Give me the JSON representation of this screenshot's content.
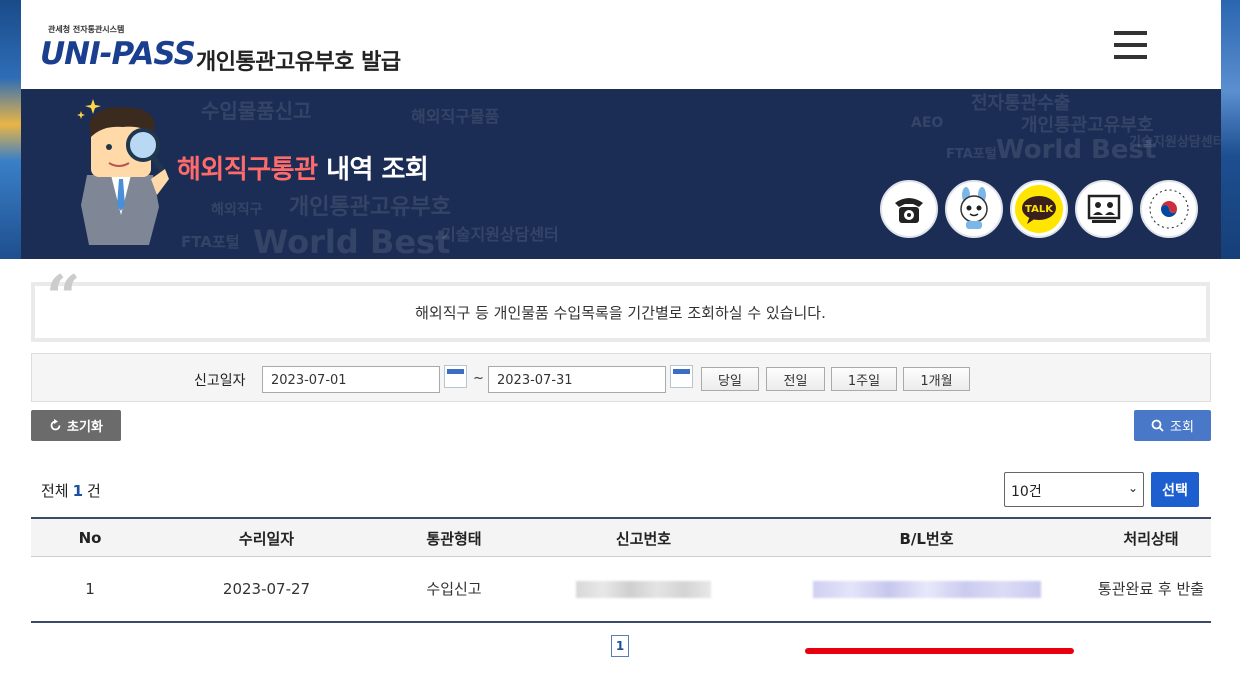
{
  "header": {
    "logo_small": "관세청 전자통관시스템",
    "logo_main": "UNI-PASS",
    "site_title": "개인통관고유부호 발급"
  },
  "banner": {
    "title_accent": "해외직구통관",
    "title_rest": " 내역 조회",
    "bg_words": [
      "수입물품신고",
      "해외직구물품",
      "개인통관고유부호",
      "World Best",
      "기술지원상담센터",
      "FTA포털",
      "전자통관수출",
      "AEO",
      "해외직구"
    ],
    "icons": [
      "phone-icon",
      "mascot-icon",
      "talk-icon",
      "consult-icon",
      "government-emblem-icon"
    ],
    "talk_label": "TALK"
  },
  "info": {
    "text": "해외직구 등 개인물품 수입목록을 기간별로 조회하실 수 있습니다."
  },
  "search": {
    "label": "신고일자",
    "date_from": "2023-07-01",
    "date_to": "2023-07-31",
    "tilde": "~",
    "periods": [
      "당일",
      "전일",
      "1주일",
      "1개월"
    ]
  },
  "actions": {
    "reset_label": "초기화",
    "query_label": "조회"
  },
  "results": {
    "total_prefix": "전체",
    "total_count": "1",
    "total_suffix": "건",
    "page_size": "10건",
    "select_label": "선택"
  },
  "table": {
    "columns": [
      "No",
      "수리일자",
      "통관형태",
      "신고번호",
      "B/L번호",
      "처리상태"
    ],
    "rows": [
      {
        "no": "1",
        "date": "2023-07-27",
        "type": "수입신고",
        "status": "통관완료 후 반출"
      }
    ]
  },
  "pagination": {
    "current": "1"
  },
  "colors": {
    "banner_bg": "#1c2d55",
    "accent_red": "#ff6b6b",
    "primary_blue": "#4a78c9",
    "select_blue": "#1d5fcf",
    "highlight_red": "#e8000f"
  }
}
